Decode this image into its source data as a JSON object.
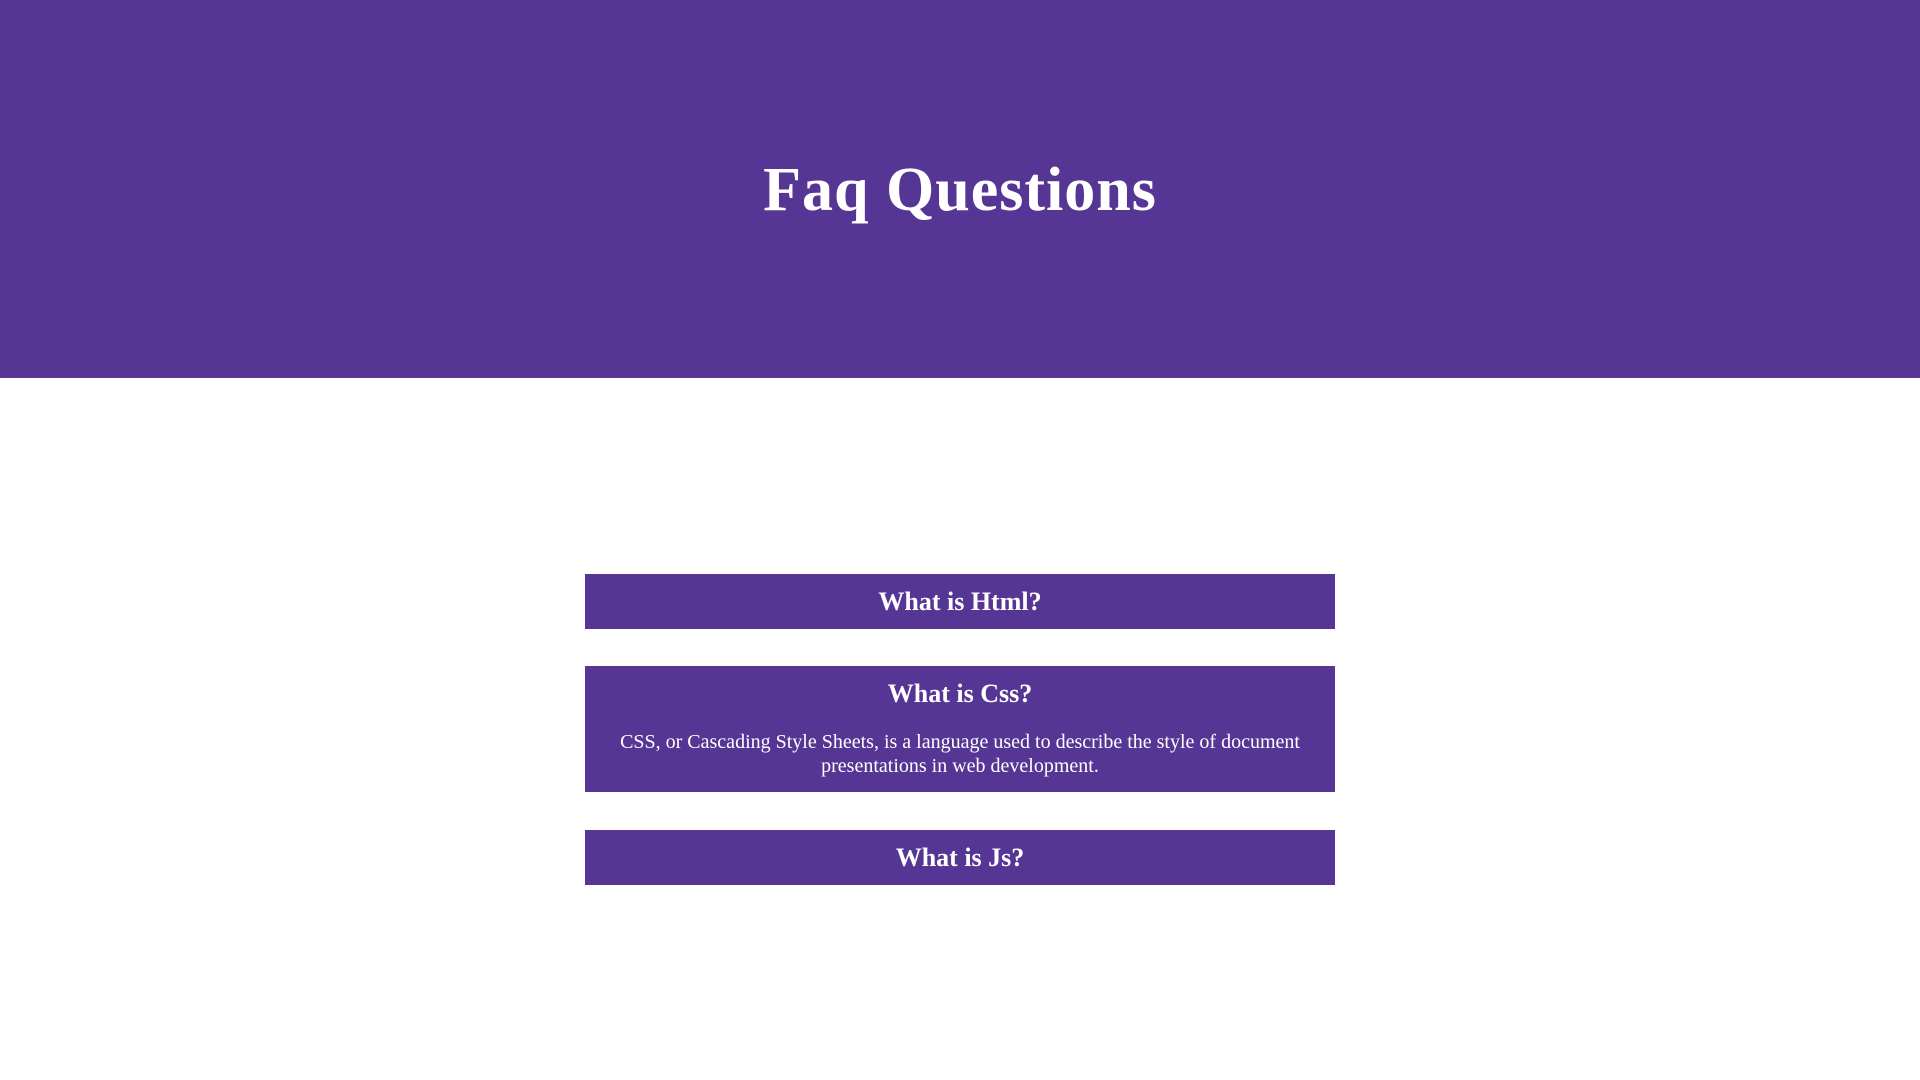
{
  "header": {
    "title": "Faq Questions"
  },
  "colors": {
    "accent": "#563695",
    "background": "#ffffff",
    "text_on_accent": "#ffffff"
  },
  "faq": {
    "items": [
      {
        "question": "What is Html?",
        "expanded": false
      },
      {
        "question": "What is Css?",
        "answer": "CSS, or Cascading Style Sheets, is a language used to describe the style of document presentations in web development.",
        "expanded": true
      },
      {
        "question": "What is Js?",
        "expanded": false
      }
    ]
  }
}
